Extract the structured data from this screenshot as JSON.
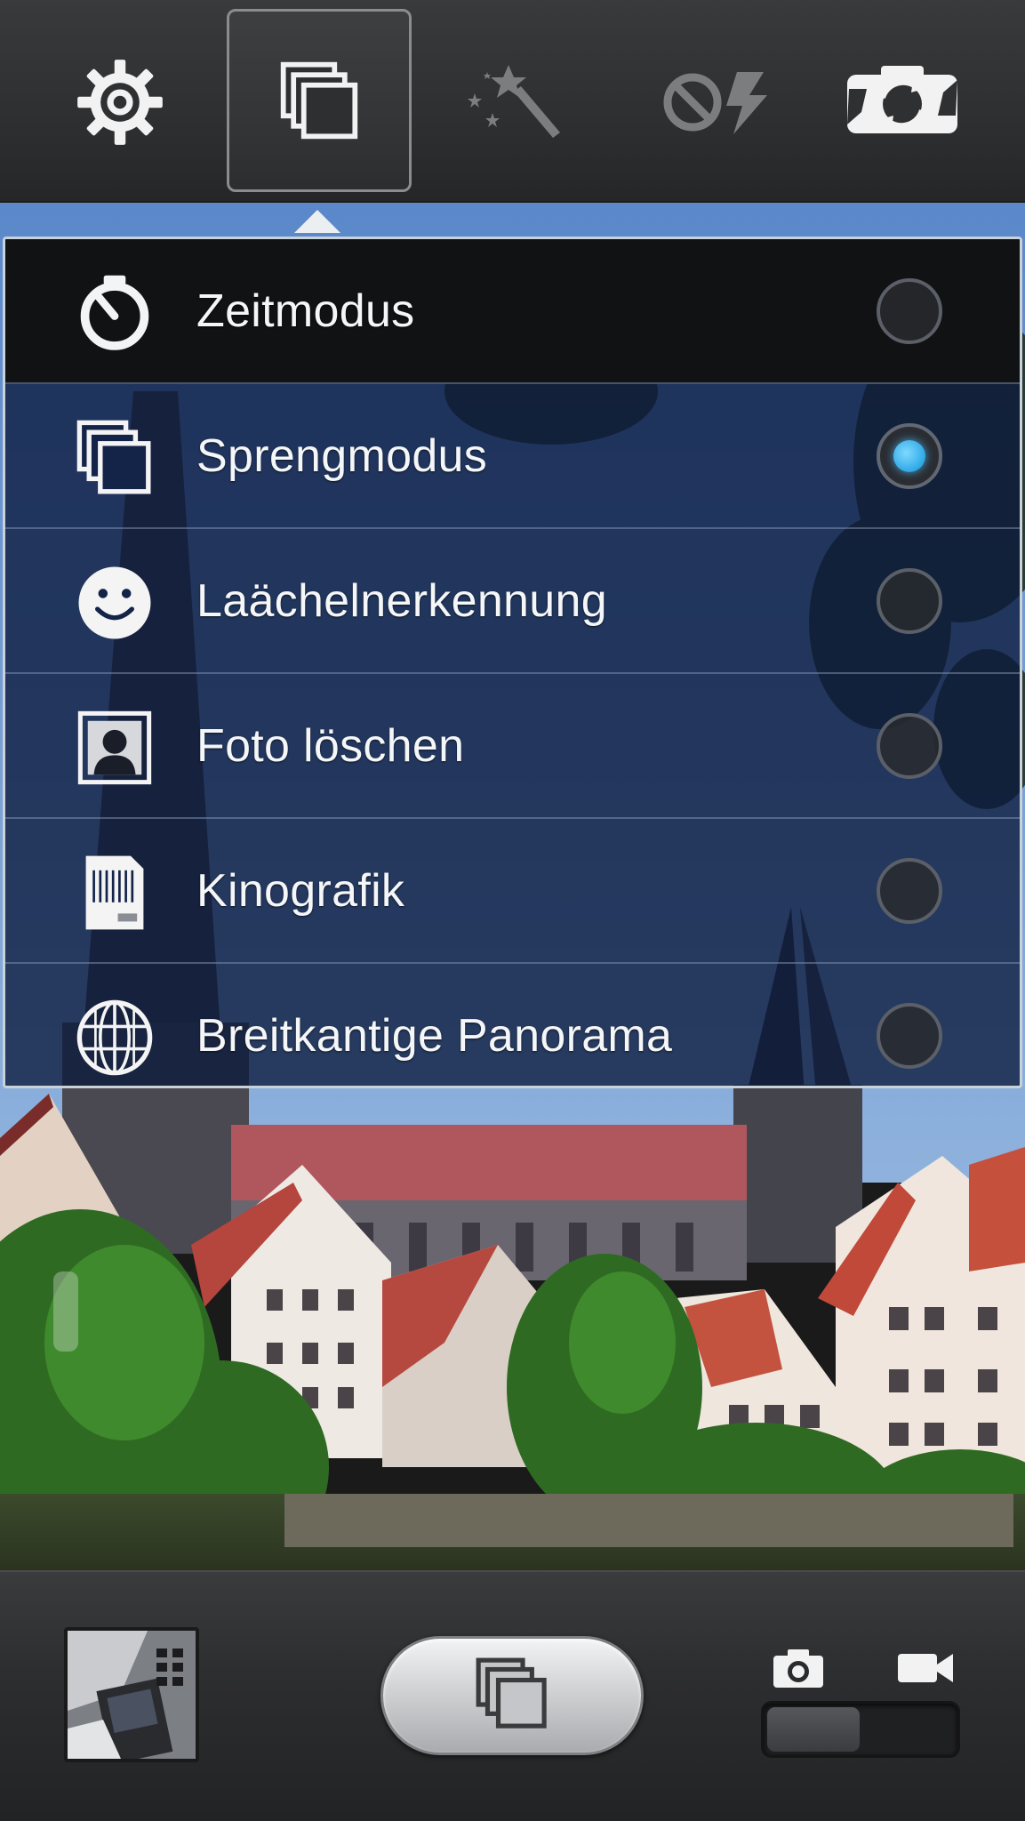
{
  "toolbar": {
    "buttons": [
      {
        "id": "settings",
        "icon": "gear-icon"
      },
      {
        "id": "shooting_mode",
        "icon": "burst-stack-icon",
        "selected": true
      },
      {
        "id": "effects",
        "icon": "magic-wand-icon",
        "enabled": false
      },
      {
        "id": "flash",
        "icon": "flash-off-icon",
        "enabled": false
      },
      {
        "id": "switch_camera",
        "icon": "switch-camera-icon"
      }
    ]
  },
  "mode_menu": {
    "items": [
      {
        "label": "Zeitmodus",
        "icon": "timer-icon",
        "selected": false
      },
      {
        "label": "Sprengmodus",
        "icon": "burst-stack-icon",
        "selected": true
      },
      {
        "label": "Laächelnerkennung",
        "icon": "smile-icon",
        "selected": false
      },
      {
        "label": "Foto löschen",
        "icon": "portrait-erase-icon",
        "selected": false
      },
      {
        "label": "Kinografik",
        "icon": "cinemagraph-icon",
        "selected": false
      },
      {
        "label": "Breitkantige Panorama",
        "icon": "globe-panorama-icon",
        "selected": false
      }
    ]
  },
  "bottom_bar": {
    "gallery_thumbnail": "gallery-thumbnail",
    "shutter_icon": "burst-stack-icon",
    "capture_modes": [
      "camera-icon",
      "video-camera-icon"
    ],
    "active_capture_mode": "camera"
  },
  "colors": {
    "toolbar_bg": "#2c2d2f",
    "menu_overlay": "#0c1a3c",
    "radio_selected": "#2fa9e6",
    "label_text": "#f4f6f8"
  }
}
